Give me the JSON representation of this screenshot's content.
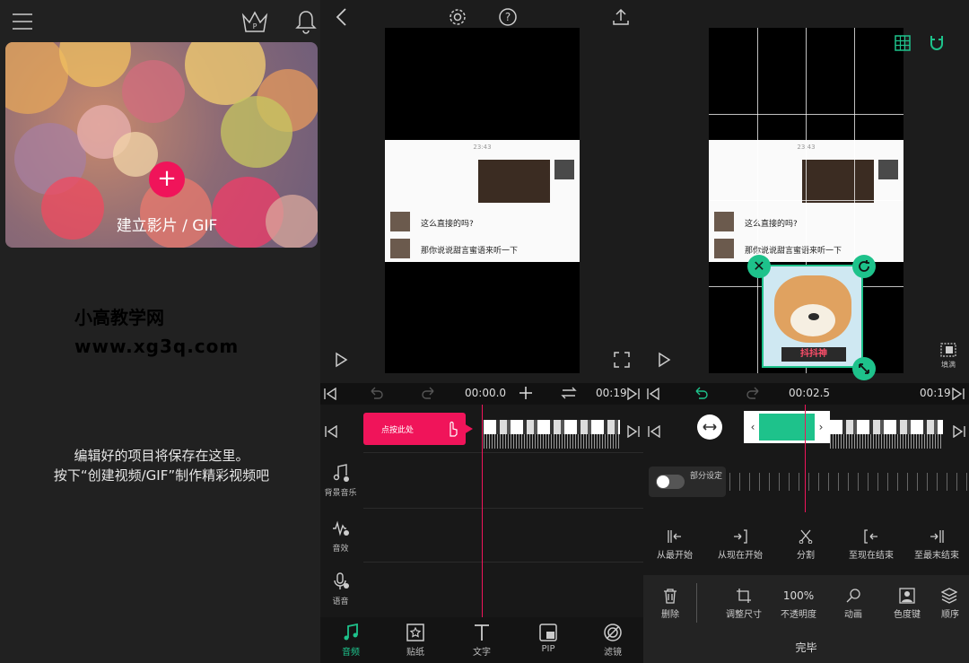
{
  "home": {
    "create_label": "建立影片 / GIF",
    "watermark_line1": "小高教学网",
    "watermark_line2": "www.xg3q.com",
    "hint_line1": "编辑好的项目将保存在这里。",
    "hint_line2": "按下“创建视频/GIF”制作精彩视频吧",
    "icons": [
      "menu-icon",
      "premium-crown-icon",
      "bell-icon"
    ]
  },
  "editor": {
    "time_current": "00:00.0",
    "time_total": "00:19",
    "tap_hint": "点按此处",
    "chat": {
      "time": "23:43",
      "message1": "这么直接的吗?",
      "message2": "那你说说甜言蜜语来听一下"
    },
    "side_tracks": [
      {
        "label": "背景音乐"
      },
      {
        "label": "音效"
      },
      {
        "label": "语音"
      }
    ],
    "bottom_tabs": [
      {
        "label": "音频",
        "active": true
      },
      {
        "label": "贴纸",
        "active": false
      },
      {
        "label": "文字",
        "active": false
      },
      {
        "label": "PIP",
        "active": false
      },
      {
        "label": "滤镜",
        "active": false
      }
    ]
  },
  "sticker_editor": {
    "time_current": "00:02.5",
    "time_total": "00:19",
    "fill_label": "填满",
    "sticker_caption": "抖抖神",
    "partial_toggle_label": "部分设定",
    "trim_actions": [
      {
        "label": "从最开始"
      },
      {
        "label": "从现在开始"
      },
      {
        "label": "分割"
      },
      {
        "label": "至现在结束"
      },
      {
        "label": "至最末结束"
      }
    ],
    "tools": [
      {
        "label": "删除"
      },
      {
        "label": "调整尺寸"
      },
      {
        "label": "不透明度",
        "value": "100%"
      },
      {
        "label": "动画"
      },
      {
        "label": "色度键"
      },
      {
        "label": "顺序"
      }
    ],
    "done_label": "完毕"
  },
  "colors": {
    "accent": "#f0145a",
    "green": "#1ec28b",
    "background": "#1e1e1e"
  }
}
